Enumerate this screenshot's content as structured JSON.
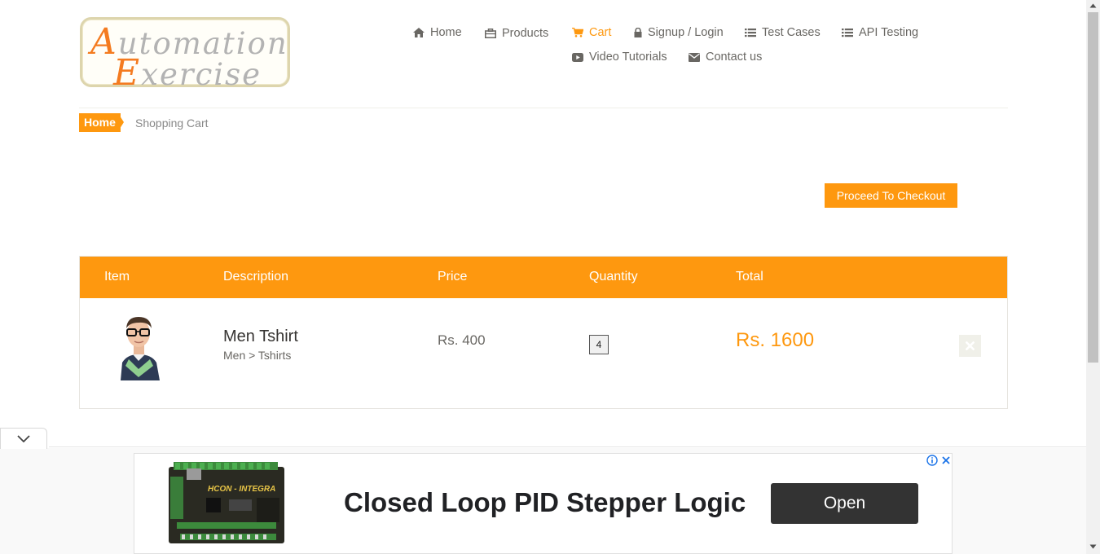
{
  "logo": {
    "line1_cap": "A",
    "line1_rest": "utomation",
    "line2_cap": "E",
    "line2_rest": "xercise"
  },
  "nav": {
    "items": [
      {
        "label": "Home",
        "icon": "home-icon"
      },
      {
        "label": "Products",
        "icon": "briefcase-icon"
      },
      {
        "label": "Cart",
        "icon": "cart-icon",
        "active": true
      },
      {
        "label": "Signup / Login",
        "icon": "lock-icon"
      },
      {
        "label": "Test Cases",
        "icon": "list-icon"
      },
      {
        "label": "API Testing",
        "icon": "list-icon"
      },
      {
        "label": "Video Tutorials",
        "icon": "youtube-play-icon"
      },
      {
        "label": "Contact us",
        "icon": "envelope-icon"
      }
    ]
  },
  "breadcrumb": {
    "home": "Home",
    "current": "Shopping Cart"
  },
  "checkout": {
    "label": "Proceed To Checkout"
  },
  "cart": {
    "headers": [
      "Item",
      "Description",
      "Price",
      "Quantity",
      "Total"
    ],
    "rows": [
      {
        "name": "Men Tshirt",
        "category": "Men > Tshirts",
        "price": "Rs. 400",
        "quantity": "4",
        "total": "Rs. 1600"
      }
    ]
  },
  "ad": {
    "title": "Closed Loop PID Stepper Logic",
    "button": "Open",
    "board_label": "HCON - INTEGRA"
  },
  "colors": {
    "accent": "#fe980f",
    "text": "#696763",
    "dark_button": "#333333"
  }
}
